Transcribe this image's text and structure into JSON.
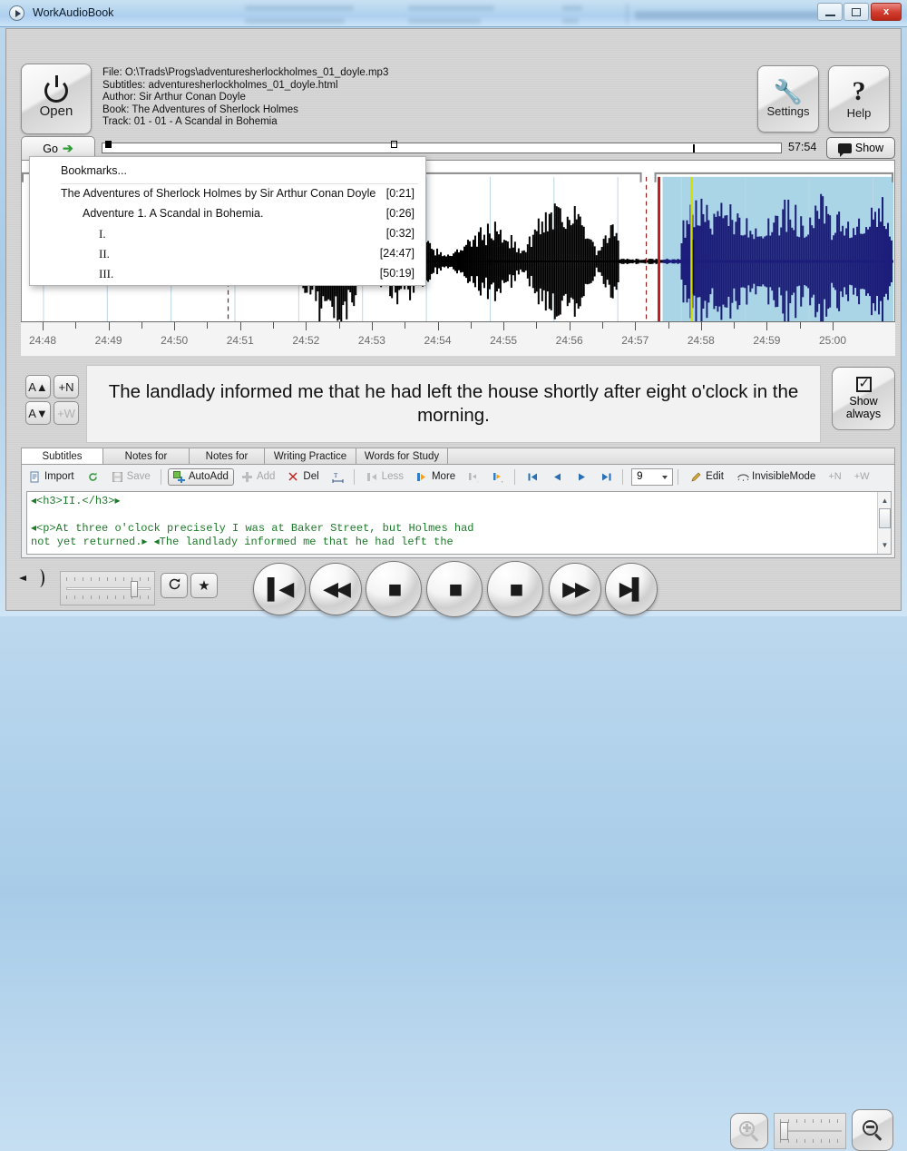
{
  "window": {
    "title": "WorkAudioBook",
    "app_icon": "play-circle-icon",
    "minimize_label": "",
    "maximize_label": "",
    "close_label": "x"
  },
  "header": {
    "open_label": "Open",
    "settings_label": "Settings",
    "help_label": "Help",
    "file_info": {
      "file": "File:  O:\\Trads\\Progs\\adventuresherlockholmes_01_doyle.mp3",
      "subtitles": "Subtitles:  adventuresherlockholmes_01_doyle.html",
      "author": "Author:  Sir Arthur Conan Doyle",
      "book": "Book:  The Adventures of Sherlock Holmes",
      "track": "Track:  01 - 01 - A Scandal in Bohemia"
    }
  },
  "seekbar": {
    "go_label": "Go",
    "go_icon": "arrow-right-icon",
    "total_time": "57:54",
    "show_label": "Show",
    "show_icon": "subtitle-balloon-icon",
    "loaded_percent": 43,
    "playhead_percent": 87
  },
  "bookmarks": {
    "header": "Bookmarks...",
    "items": [
      {
        "label": "The Adventures of Sherlock Holmes by Sir Arthur Conan Doyle",
        "time": "[0:21]",
        "level": 0
      },
      {
        "label": "Adventure 1. A Scandal in Bohemia.",
        "time": "[0:26]",
        "level": 1
      },
      {
        "label": "I.",
        "time": "[0:32]",
        "level": 2
      },
      {
        "label": "II.",
        "time": "[24:47]",
        "level": 2
      },
      {
        "label": "III.",
        "time": "[50:19]",
        "level": 2
      }
    ]
  },
  "waveform": {
    "axis_labels": [
      "24:48",
      "24:49",
      "24:50",
      "24:51",
      "24:52",
      "24:53",
      "24:54",
      "24:55",
      "24:56",
      "24:57",
      "24:58",
      "24:59",
      "25:00"
    ],
    "selection_color": "#a9d5e6",
    "selected_wave_color": "#1c1c7a",
    "wave_color": "#000000",
    "playhead_color": "#c01f1f",
    "marker_color": "#d4e000",
    "cursor_dashed_color": "#8b2020"
  },
  "subtitle": {
    "text": "The landlady informed me that he had left the house shortly after eight o'clock in the morning.",
    "font_up_label": "A",
    "font_down_label": "A",
    "add_note_label": "N",
    "add_word_label": "W",
    "show_always_label_line1": "Show",
    "show_always_label_line2": "always",
    "show_always_checked": true
  },
  "tabs": [
    {
      "label": "Subtitles Editor",
      "active": true
    },
    {
      "label": "Notes for Folder",
      "active": false
    },
    {
      "label": "Notes for File",
      "active": false
    },
    {
      "label": "Writing Practice",
      "active": false
    },
    {
      "label": "Words for Study",
      "active": false
    }
  ],
  "toolbar": {
    "import_label": "Import",
    "import_icon": "document-icon",
    "refresh_icon": "refresh-icon",
    "save_label": "Save",
    "save_icon": "floppy-disk-icon",
    "autoadd_label": "AutoAdd",
    "autoadd_icon": "plus-badge-icon",
    "add_label": "Add",
    "add_icon": "plus-icon",
    "del_label": "Del",
    "del_icon": "scissors-icon",
    "split_icon": "split-text-icon",
    "less_label": "Less",
    "less_icon": "shrink-left-icon",
    "more_label": "More",
    "more_icon": "grow-right-icon",
    "nudge_left_icon": "nudge-left-icon",
    "nudge_right_icon": "nudge-right-icon",
    "first_icon": "skip-first-icon",
    "prev_icon": "prev-icon",
    "next_icon": "next-icon",
    "last_icon": "skip-last-icon",
    "page_value": "9",
    "edit_label": "Edit",
    "edit_icon": "pencil-icon",
    "invisible_label": "InvisibleMode",
    "invisible_icon": "closed-eye-icon",
    "note_icon": "add-note-icon",
    "word_icon": "add-word-icon"
  },
  "code_editor": {
    "line1": "◂<h3>II.</h3>▸",
    "line2": "",
    "line3": "◂<p>At three o'clock precisely I was at Baker Street, but Holmes had",
    "line4": "not yet returned.▸ ◂The landlady informed me that he had left the"
  },
  "transport": {
    "speaker_icon": "speaker-icon",
    "volume_percent": 76,
    "loop_icon": "loop-icon",
    "star_icon": "star-icon",
    "buttons": [
      {
        "name": "prev-track-button",
        "glyph": "▌◀"
      },
      {
        "name": "rewind-button",
        "glyph": "◀◀"
      },
      {
        "name": "stop-button-1",
        "glyph": "■"
      },
      {
        "name": "stop-button-2",
        "glyph": "■"
      },
      {
        "name": "stop-button-3",
        "glyph": "■"
      },
      {
        "name": "forward-button",
        "glyph": "▶▶"
      },
      {
        "name": "next-track-button",
        "glyph": "▶▌"
      }
    ],
    "zoom_in_icon": "zoom-in-icon",
    "zoom_out_icon": "zoom-out-icon",
    "zoom_percent": 2
  }
}
